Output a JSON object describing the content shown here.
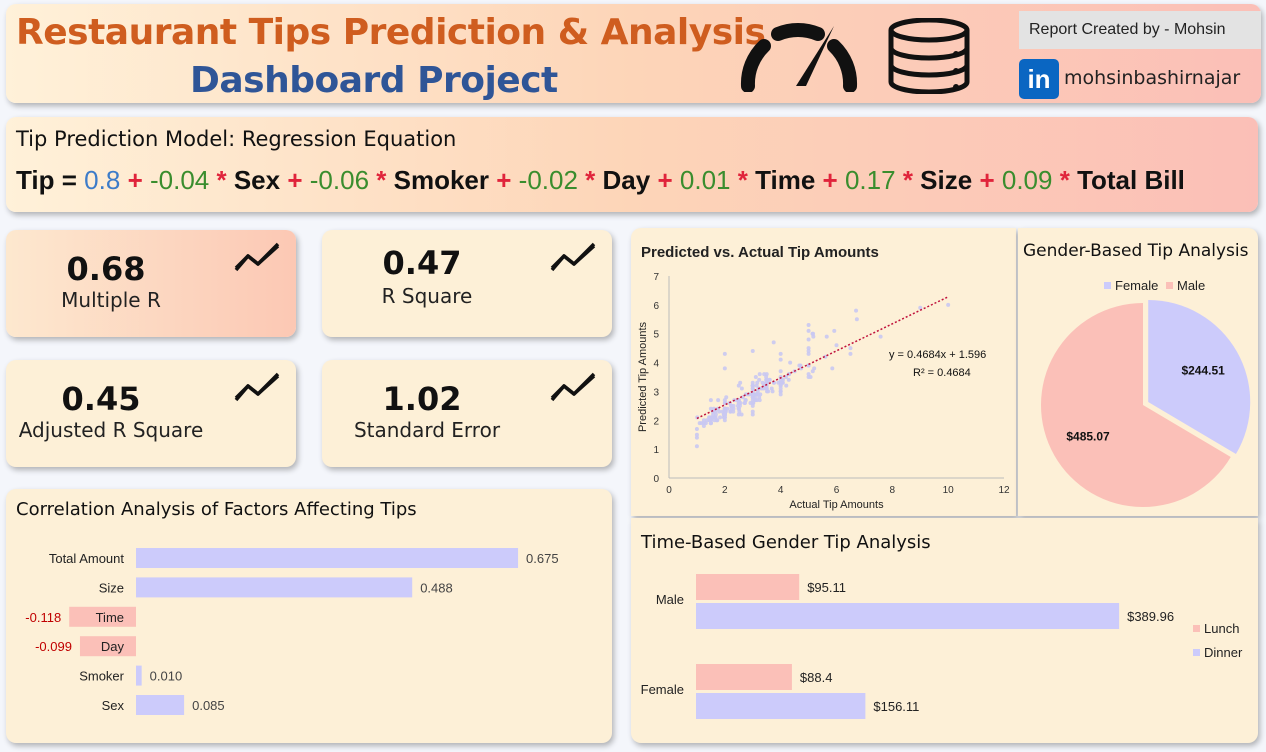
{
  "header": {
    "title_line1": "Restaurant Tips Prediction & Analysis",
    "title_line2": "Dashboard Project",
    "report_credit": "Report Created by - Mohsin",
    "linkedin_handle": "mohsinbashirnajar",
    "linkedin_glyph": "in",
    "icons": [
      "speedometer-icon",
      "database-icon",
      "linkedin-icon"
    ]
  },
  "regression": {
    "title": "Tip Prediction Model: Regression Equation",
    "equation": {
      "lhs": "Tip =",
      "intercept": "0.8",
      "terms": [
        {
          "op": "+",
          "coef": "-0.04",
          "mul": "*",
          "var": "Sex"
        },
        {
          "op": "+",
          "coef": "-0.06",
          "mul": "*",
          "var": "Smoker"
        },
        {
          "op": "+",
          "coef": "-0.02",
          "mul": "*",
          "var": "Day"
        },
        {
          "op": "+",
          "coef": "0.01",
          "mul": "*",
          "var": "Time"
        },
        {
          "op": "+",
          "coef": "0.17",
          "mul": "*",
          "var": "Size"
        },
        {
          "op": "+",
          "coef": "0.09",
          "mul": "*",
          "var": "Total Bill"
        }
      ]
    }
  },
  "kpis": [
    {
      "value": "0.68",
      "label": "Multiple R"
    },
    {
      "value": "0.47",
      "label": "R Square"
    },
    {
      "value": "0.45",
      "label": "Adjusted R Square"
    },
    {
      "value": "1.02",
      "label": "Standard Error"
    }
  ],
  "colors": {
    "series_purple": "#cccbfb",
    "series_pink": "#fbc0b8",
    "negative_red": "#c00000",
    "title_orange": "#cf5d1f",
    "title_blue": "#2f5597"
  },
  "chart_data": [
    {
      "type": "bar",
      "orientation": "horizontal",
      "title": "Correlation Analysis of Factors Affecting Tips",
      "categories": [
        "Total Amount",
        "Size",
        "Time",
        "Day",
        "Smoker",
        "Sex"
      ],
      "values": [
        0.675,
        0.488,
        -0.118,
        -0.099,
        0.01,
        0.085
      ],
      "labels": [
        "0.675",
        "0.488",
        "-0.118",
        "-0.099",
        "0.010",
        "0.085"
      ]
    },
    {
      "type": "scatter",
      "title": "Predicted vs. Actual Tip Amounts",
      "xlabel": "Actual Tip Amounts",
      "ylabel": "Predicted Tip Amounts",
      "xlim": [
        0,
        12
      ],
      "ylim": [
        0,
        7
      ],
      "xticks": [
        "0",
        "2",
        "4",
        "6",
        "8",
        "10",
        "12"
      ],
      "yticks": [
        "0",
        "1",
        "2",
        "3",
        "4",
        "5",
        "6",
        "7"
      ],
      "trendline": {
        "slope": 0.4684,
        "intercept": 1.596,
        "r2": 0.4684,
        "equation_label": "y = 0.4684x + 1.596",
        "r2_label": "R² = 0.4684"
      },
      "points": [
        [
          1.01,
          2.1
        ],
        [
          1.66,
          2.3
        ],
        [
          3.5,
          3.2
        ],
        [
          3.31,
          3.1
        ],
        [
          3.61,
          3.4
        ],
        [
          4.71,
          3.9
        ],
        [
          2.0,
          2.4
        ],
        [
          3.12,
          2.9
        ],
        [
          1.96,
          2.2
        ],
        [
          3.23,
          2.8
        ],
        [
          1.71,
          2.0
        ],
        [
          5.0,
          4.3
        ],
        [
          1.57,
          2.3
        ],
        [
          3.0,
          3.0
        ],
        [
          3.02,
          2.6
        ],
        [
          3.92,
          3.3
        ],
        [
          1.67,
          2.1
        ],
        [
          3.71,
          3.0
        ],
        [
          3.5,
          3.1
        ],
        [
          3.35,
          3.3
        ],
        [
          4.08,
          3.4
        ],
        [
          2.75,
          2.7
        ],
        [
          2.23,
          2.5
        ],
        [
          7.58,
          4.9
        ],
        [
          3.18,
          3.0
        ],
        [
          2.34,
          2.7
        ],
        [
          2.0,
          2.3
        ],
        [
          2.0,
          2.4
        ],
        [
          4.3,
          3.6
        ],
        [
          3.0,
          2.8
        ],
        [
          1.45,
          2.0
        ],
        [
          2.5,
          2.7
        ],
        [
          3.0,
          2.6
        ],
        [
          2.45,
          2.7
        ],
        [
          3.27,
          2.9
        ],
        [
          3.6,
          3.4
        ],
        [
          2.0,
          2.3
        ],
        [
          3.07,
          2.7
        ],
        [
          2.31,
          2.4
        ],
        [
          5.0,
          3.9
        ],
        [
          2.24,
          2.5
        ],
        [
          2.54,
          2.5
        ],
        [
          3.06,
          2.9
        ],
        [
          1.32,
          1.9
        ],
        [
          5.6,
          4.2
        ],
        [
          3.0,
          3.2
        ],
        [
          5.0,
          3.5
        ],
        [
          6.0,
          4.6
        ],
        [
          2.05,
          2.8
        ],
        [
          3.0,
          3.1
        ],
        [
          2.5,
          2.4
        ],
        [
          2.6,
          2.2
        ],
        [
          5.2,
          3.8
        ],
        [
          1.56,
          2.1
        ],
        [
          4.34,
          4.0
        ],
        [
          3.51,
          3.0
        ],
        [
          3.0,
          4.4
        ],
        [
          1.5,
          2.7
        ],
        [
          1.76,
          2.7
        ],
        [
          6.73,
          5.5
        ],
        [
          3.21,
          3.1
        ],
        [
          2.0,
          2.3
        ],
        [
          1.98,
          2.1
        ],
        [
          3.76,
          3.3
        ],
        [
          2.64,
          2.8
        ],
        [
          3.15,
          2.7
        ],
        [
          2.47,
          2.5
        ],
        [
          1.0,
          1.1
        ],
        [
          2.01,
          2.6
        ],
        [
          2.09,
          2.4
        ],
        [
          1.97,
          2.1
        ],
        [
          3.0,
          2.8
        ],
        [
          3.14,
          3.2
        ],
        [
          5.0,
          3.6
        ],
        [
          2.2,
          2.3
        ],
        [
          1.25,
          2.0
        ],
        [
          3.08,
          2.8
        ],
        [
          4.0,
          3.5
        ],
        [
          3.0,
          2.9
        ],
        [
          2.71,
          2.6
        ],
        [
          3.0,
          2.8
        ],
        [
          3.4,
          3.2
        ],
        [
          1.83,
          2.1
        ],
        [
          5.0,
          4.5
        ],
        [
          2.03,
          2.3
        ],
        [
          5.17,
          4.9
        ],
        [
          2.0,
          2.4
        ],
        [
          4.0,
          3.1
        ],
        [
          5.85,
          3.8
        ],
        [
          3.0,
          3.3
        ],
        [
          3.0,
          2.5
        ],
        [
          3.5,
          3.3
        ],
        [
          1.0,
          1.5
        ],
        [
          4.3,
          3.6
        ],
        [
          3.25,
          3.6
        ],
        [
          4.73,
          3.8
        ],
        [
          4.0,
          3.0
        ],
        [
          1.5,
          1.9
        ],
        [
          3.0,
          2.3
        ],
        [
          1.5,
          1.9
        ],
        [
          2.5,
          2.4
        ],
        [
          3.0,
          3.2
        ],
        [
          2.5,
          3.2
        ],
        [
          3.48,
          3.5
        ],
        [
          4.08,
          3.3
        ],
        [
          1.64,
          2.1
        ],
        [
          4.06,
          3.3
        ],
        [
          4.29,
          3.4
        ],
        [
          3.76,
          3.3
        ],
        [
          4.0,
          2.9
        ],
        [
          3.0,
          2.2
        ],
        [
          1.0,
          1.4
        ],
        [
          4.0,
          4.3
        ],
        [
          2.55,
          3.3
        ],
        [
          4.0,
          3.4
        ],
        [
          3.5,
          3.3
        ],
        [
          5.07,
          3.5
        ],
        [
          1.5,
          2.0
        ],
        [
          1.8,
          2.3
        ],
        [
          2.92,
          2.6
        ],
        [
          2.31,
          2.5
        ],
        [
          1.68,
          2.2
        ],
        [
          2.5,
          2.2
        ],
        [
          2.0,
          2.2
        ],
        [
          2.52,
          2.3
        ],
        [
          4.2,
          3.2
        ],
        [
          1.48,
          2.0
        ],
        [
          2.0,
          2.1
        ],
        [
          2.0,
          2.6
        ],
        [
          2.18,
          2.6
        ],
        [
          1.5,
          1.9
        ],
        [
          2.83,
          2.9
        ],
        [
          1.5,
          2.0
        ],
        [
          2.0,
          2.1
        ],
        [
          3.25,
          2.7
        ],
        [
          1.25,
          1.9
        ],
        [
          2.0,
          2.0
        ],
        [
          2.0,
          2.1
        ],
        [
          2.0,
          2.2
        ],
        [
          2.75,
          2.9
        ],
        [
          3.5,
          3.3
        ],
        [
          6.7,
          5.8
        ],
        [
          5.0,
          5.1
        ],
        [
          5.0,
          4.8
        ],
        [
          2.3,
          2.3
        ],
        [
          1.5,
          1.9
        ],
        [
          1.36,
          2.0
        ],
        [
          1.63,
          2.0
        ],
        [
          1.73,
          2.0
        ],
        [
          2.0,
          2.3
        ],
        [
          2.5,
          2.6
        ],
        [
          2.0,
          2.2
        ],
        [
          2.74,
          2.7
        ],
        [
          2.0,
          2.2
        ],
        [
          2.0,
          2.3
        ],
        [
          5.14,
          5.0
        ],
        [
          5.0,
          5.3
        ],
        [
          3.75,
          4.7
        ],
        [
          2.61,
          3.1
        ],
        [
          2.0,
          2.2
        ],
        [
          3.5,
          3.6
        ],
        [
          2.5,
          2.7
        ],
        [
          2.0,
          2.4
        ],
        [
          2.0,
          2.3
        ],
        [
          3.0,
          2.9
        ],
        [
          3.48,
          3.4
        ],
        [
          2.24,
          2.4
        ],
        [
          4.5,
          3.7
        ],
        [
          1.61,
          2.4
        ],
        [
          2.0,
          2.3
        ],
        [
          10.0,
          6.0
        ],
        [
          3.16,
          3.3
        ],
        [
          5.15,
          3.7
        ],
        [
          3.18,
          2.9
        ],
        [
          4.0,
          3.7
        ],
        [
          3.11,
          3.5
        ],
        [
          2.0,
          2.3
        ],
        [
          2.0,
          2.2
        ],
        [
          4.0,
          3.2
        ],
        [
          3.55,
          3.0
        ],
        [
          3.68,
          3.1
        ],
        [
          5.65,
          4.9
        ],
        [
          3.5,
          3.1
        ],
        [
          6.5,
          4.3
        ],
        [
          3.0,
          3.2
        ],
        [
          5.0,
          4.4
        ],
        [
          3.5,
          3.4
        ],
        [
          2.0,
          2.7
        ],
        [
          3.5,
          3.3
        ],
        [
          4.0,
          3.3
        ],
        [
          1.5,
          2.4
        ],
        [
          4.19,
          3.5
        ],
        [
          2.56,
          2.6
        ],
        [
          2.02,
          2.6
        ],
        [
          4.0,
          3.2
        ],
        [
          1.44,
          2.1
        ],
        [
          2.0,
          2.2
        ],
        [
          5.0,
          3.9
        ],
        [
          2.0,
          2.2
        ],
        [
          2.0,
          2.2
        ],
        [
          4.0,
          3.0
        ],
        [
          2.01,
          2.4
        ],
        [
          2.0,
          2.3
        ],
        [
          2.5,
          2.4
        ],
        [
          4.0,
          4.1
        ],
        [
          3.23,
          3.4
        ],
        [
          3.41,
          3.6
        ],
        [
          3.0,
          3.2
        ],
        [
          2.03,
          2.3
        ],
        [
          2.23,
          2.5
        ],
        [
          2.0,
          2.4
        ],
        [
          5.16,
          5.0
        ],
        [
          9.0,
          5.9
        ],
        [
          2.5,
          2.6
        ],
        [
          6.5,
          4.5
        ],
        [
          1.1,
          1.9
        ],
        [
          3.0,
          2.9
        ],
        [
          1.5,
          2.1
        ],
        [
          1.44,
          2.1
        ],
        [
          3.09,
          2.7
        ],
        [
          2.2,
          2.3
        ],
        [
          3.48,
          3.3
        ],
        [
          1.92,
          2.3
        ],
        [
          3.0,
          2.7
        ],
        [
          1.58,
          2.2
        ],
        [
          2.5,
          2.6
        ],
        [
          2.0,
          2.3
        ],
        [
          3.0,
          3.2
        ],
        [
          2.72,
          2.6
        ],
        [
          2.88,
          2.9
        ],
        [
          2.0,
          2.2
        ],
        [
          3.0,
          2.9
        ],
        [
          3.39,
          3.1
        ],
        [
          1.47,
          2.0
        ],
        [
          3.0,
          2.9
        ],
        [
          1.25,
          1.8
        ],
        [
          1.0,
          1.7
        ],
        [
          1.17,
          1.9
        ],
        [
          4.67,
          3.9
        ],
        [
          5.92,
          5.1
        ],
        [
          2.0,
          4.3
        ],
        [
          2.0,
          3.8
        ],
        [
          1.75,
          2.4
        ],
        [
          3.0,
          3.1
        ]
      ]
    },
    {
      "type": "pie",
      "title": "Gender-Based Tip Analysis",
      "legend_position": "top",
      "categories": [
        "Female",
        "Male"
      ],
      "values": [
        244.51,
        485.07
      ],
      "labels": [
        "$244.51",
        "$485.07"
      ]
    },
    {
      "type": "bar",
      "orientation": "horizontal",
      "title": "Time-Based Gender Tip Analysis",
      "categories": [
        "Male",
        "Female"
      ],
      "series": [
        {
          "name": "Lunch",
          "values": [
            95.11,
            88.4
          ],
          "labels": [
            "$95.11",
            "$88.4"
          ]
        },
        {
          "name": "Dinner",
          "values": [
            389.96,
            156.11
          ],
          "labels": [
            "$389.96",
            "$156.11"
          ]
        }
      ],
      "legend_position": "right"
    }
  ]
}
